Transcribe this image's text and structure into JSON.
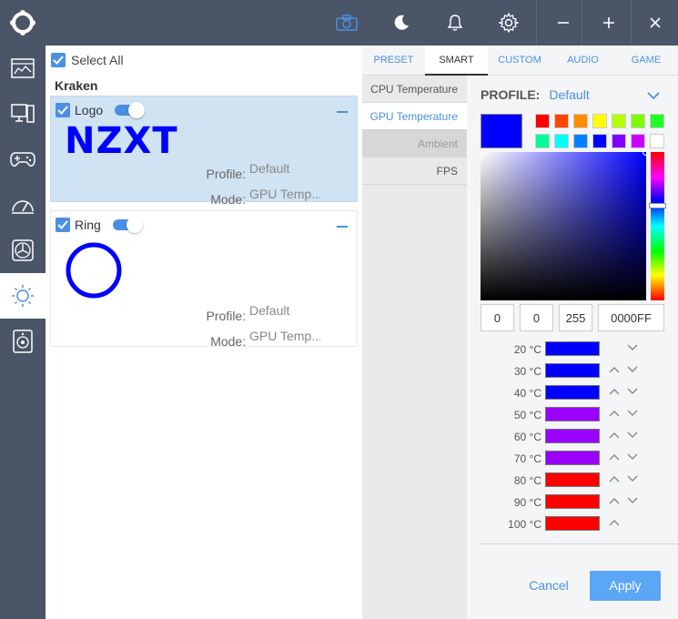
{
  "top_icons": [
    "camera-icon",
    "moon-icon",
    "bell-icon",
    "gear-icon",
    "minimize-icon",
    "maximize-icon",
    "close-icon"
  ],
  "nav": [
    "monitoring",
    "pc",
    "games",
    "tuning",
    "cooling",
    "lighting",
    "audio"
  ],
  "devices": {
    "select_all": "Select All",
    "group": "Kraken",
    "logo_card": {
      "name": "Logo",
      "logo_text": "NZXT",
      "profile_label": "Profile:",
      "profile_value": "Default",
      "mode_label": "Mode:",
      "mode_value": "GPU Temp..."
    },
    "ring_card": {
      "name": "Ring",
      "profile_label": "Profile:",
      "profile_value": "Default",
      "mode_label": "Mode:",
      "mode_value": "GPU Temp..."
    },
    "ring_color": "#0000ff"
  },
  "tabs": [
    "PRESET",
    "SMART",
    "CUSTOM",
    "AUDIO",
    "GAME"
  ],
  "smart_items": [
    "CPU Temperature",
    "GPU Temperature",
    "Ambient",
    "FPS"
  ],
  "profile": {
    "label": "PROFILE:",
    "value": "Default"
  },
  "color": {
    "current": "#0000ff",
    "swatches": [
      "#ff0000",
      "#ff4500",
      "#ff8c00",
      "#ffff00",
      "#b5ff00",
      "#7cfc00",
      "#22ff22",
      "#00ff99",
      "#00ffff",
      "#0080ff",
      "#0000ff",
      "#8000ff",
      "#cc00ff",
      "#ffffff"
    ],
    "r": "0",
    "g": "0",
    "b": "255",
    "hex": "0000FF"
  },
  "gradient": [
    {
      "temp": "20 °C",
      "color": "#0000ff"
    },
    {
      "temp": "30 °C",
      "color": "#0000ff"
    },
    {
      "temp": "40 °C",
      "color": "#0000ff"
    },
    {
      "temp": "50 °C",
      "color": "#9900ff"
    },
    {
      "temp": "60 °C",
      "color": "#9900ff"
    },
    {
      "temp": "70 °C",
      "color": "#9900ff"
    },
    {
      "temp": "80 °C",
      "color": "#ff0000"
    },
    {
      "temp": "90 °C",
      "color": "#ff0000"
    },
    {
      "temp": "100 °C",
      "color": "#ff0000"
    }
  ],
  "buttons": {
    "cancel": "Cancel",
    "apply": "Apply"
  },
  "accent": "#4a90e2"
}
